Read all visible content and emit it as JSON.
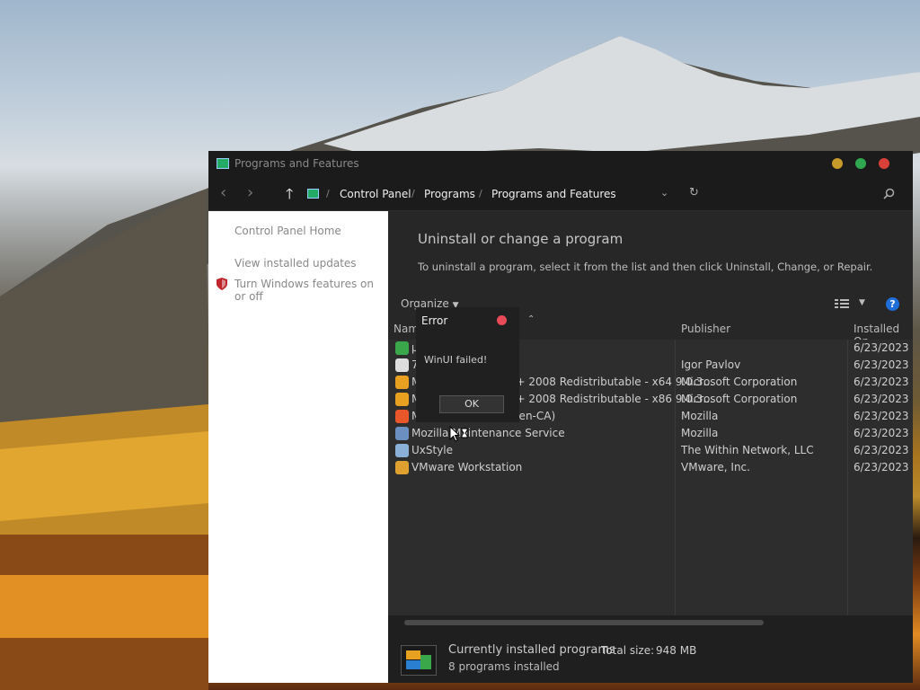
{
  "window": {
    "title": "Programs and Features",
    "traffic_lights": {
      "minimize": "#c79a2a",
      "maximize": "#2fa84f",
      "close": "#d9403a"
    }
  },
  "nav": {
    "back_icon": "chevron-left-icon",
    "forward_icon": "chevron-right-icon",
    "up_icon": "arrow-up-icon",
    "breadcrumb": [
      "Control Panel",
      "Programs",
      "Programs and Features"
    ],
    "dropdown_icon": "chevron-down-icon",
    "refresh_icon": "refresh-icon",
    "search_icon": "search-icon"
  },
  "sidebar": {
    "home": "Control Panel Home",
    "updates": "View installed updates",
    "features": "Turn Windows features on or off"
  },
  "main": {
    "heading": "Uninstall or change a program",
    "instructions": "To uninstall a program, select it from the list and then click Uninstall, Change, or Repair.",
    "organize": "Organize",
    "columns": {
      "name": "Name",
      "publisher": "Publisher",
      "installed_on": "Installed On"
    },
    "programs": [
      {
        "name": "µTorrent",
        "publisher": "",
        "installed_on": "6/23/2023",
        "icon_color": "#3aa84a"
      },
      {
        "name": "7-Zip",
        "publisher": "Igor Pavlov",
        "installed_on": "6/23/2023",
        "icon_color": "#dddddd"
      },
      {
        "name": "Microsoft Visual C++ 2008 Redistributable - x64 9.0.3...",
        "publisher": "Microsoft Corporation",
        "installed_on": "6/23/2023",
        "icon_color": "#e8a020"
      },
      {
        "name": "Microsoft Visual C++ 2008 Redistributable - x86 9.0.3...",
        "publisher": "Microsoft Corporation",
        "installed_on": "6/23/2023",
        "icon_color": "#e8a020"
      },
      {
        "name": "Mozilla Firefox (x64 en-CA)",
        "publisher": "Mozilla",
        "installed_on": "6/23/2023",
        "icon_color": "#e8562a"
      },
      {
        "name": "Mozilla Maintenance Service",
        "publisher": "Mozilla",
        "installed_on": "6/23/2023",
        "icon_color": "#6a8fc0"
      },
      {
        "name": "UxStyle",
        "publisher": "The Within Network, LLC",
        "installed_on": "6/23/2023",
        "icon_color": "#8ab0d8"
      },
      {
        "name": "VMware Workstation",
        "publisher": "VMware, Inc.",
        "installed_on": "6/23/2023",
        "icon_color": "#e0a030"
      }
    ]
  },
  "status": {
    "label": "Currently installed programs",
    "total_size_label": "Total size:",
    "total_size": "948 MB",
    "count": "8 programs installed"
  },
  "dialog": {
    "title": "Error",
    "message": "WinUI failed!",
    "ok": "OK"
  }
}
